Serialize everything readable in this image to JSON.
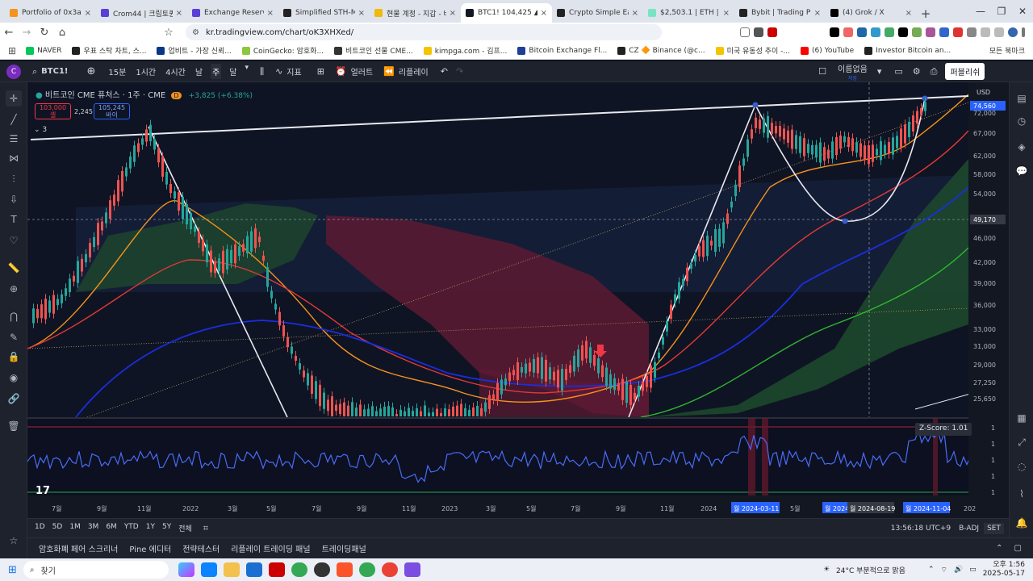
{
  "browser": {
    "tabs": [
      {
        "title": "Portfolio of 0x3a09...",
        "color": "#f7931a"
      },
      {
        "title": "Crom44 | 크립토퀀트",
        "color": "#5a3fd6"
      },
      {
        "title": "Exchange Reserve / S",
        "color": "#5a3fd6"
      },
      {
        "title": "Simplified STH-MVRV",
        "color": "#222222"
      },
      {
        "title": "현물 계정 - 지갑 - 바",
        "color": "#f0b90b"
      },
      {
        "title": "BTC1! 104,425 ▲",
        "color": "#131722"
      },
      {
        "title": "Crypto Simple Earn |",
        "color": "#222222"
      },
      {
        "title": "$2,503.1 | ETH | Hype",
        "color": "#79e4c4"
      },
      {
        "title": "Bybit | Trading Platfo",
        "color": "#222222"
      },
      {
        "title": "(4) Grok / X",
        "color": "#000000"
      }
    ],
    "url": "kr.tradingview.com/chart/oK3XHXed/",
    "bookmarks": [
      {
        "label": "NAVER",
        "color": "#03c75a"
      },
      {
        "label": "우표 스탁 차트, 스...",
        "color": "#222222"
      },
      {
        "label": "업비트 - 가장 신뢰...",
        "color": "#093687"
      },
      {
        "label": "CoinGecko: 암호화...",
        "color": "#8dc63f"
      },
      {
        "label": "비트코인 선물 CME...",
        "color": "#333333"
      },
      {
        "label": "kimpga.com - 김프...",
        "color": "#f5c400"
      },
      {
        "label": "Bitcoin Exchange Fl...",
        "color": "#1f3d99"
      },
      {
        "label": "CZ 🔶 Binance (@c...",
        "color": "#222222"
      },
      {
        "label": "미국 유동성 추이 -...",
        "color": "#f5c400"
      },
      {
        "label": "(6) YouTube",
        "color": "#ff0000"
      },
      {
        "label": "Investor Bitcoin an...",
        "color": "#222222"
      }
    ],
    "all_bookmarks": "모든 북마크"
  },
  "toolbar": {
    "symbol": "BTC1!",
    "intervals": [
      "15분",
      "1시간",
      "4시간",
      "날",
      "주",
      "달"
    ],
    "active_interval": "주",
    "indicators": "지표",
    "alert": "얼러트",
    "replay": "리플레이",
    "layout_name": "이름없음",
    "layout_sub": "저장",
    "publish": "퍼블리쉬"
  },
  "legend": {
    "title": "비트코인 CME 퓨처스 · 1주 · CME",
    "change": "+3,825 (+6.38%)",
    "sell_price": "103,000",
    "sell_label": "셀",
    "spread": "2,245",
    "buy_price": "105,245",
    "buy_label": "바이",
    "collapse": "3"
  },
  "price_axis": {
    "currency": "USD",
    "labels": [
      "74,560",
      "72,000",
      "67,000",
      "62,000",
      "58,000",
      "54,000",
      "49,170",
      "46,000",
      "42,000",
      "39,000",
      "36,000",
      "33,000",
      "31,000",
      "29,000",
      "27,250",
      "25,650"
    ],
    "current_price": "74,560",
    "crosshair_price": "49,170"
  },
  "time_axis": {
    "labels": [
      "7월",
      "9월",
      "11월",
      "2022",
      "3월",
      "5월",
      "7월",
      "9월",
      "11월",
      "2023",
      "3월",
      "5월",
      "7월",
      "9월",
      "11월",
      "2024",
      "5월",
      "202"
    ],
    "highlights": [
      "월 2024-03-11",
      "월 2024",
      "월 2024-08-19",
      "월 2024-11-04"
    ]
  },
  "zscore": {
    "label": "Z-Score: 1.01",
    "axis": [
      "1",
      "1",
      "1",
      "1",
      "1"
    ]
  },
  "range_bar": {
    "ranges": [
      "1D",
      "5D",
      "1M",
      "3M",
      "6M",
      "YTD",
      "1Y",
      "5Y",
      "전체"
    ],
    "clock": "13:56:18 UTC+9",
    "adj": "B-ADJ",
    "set": "SET"
  },
  "bottom_tabs": [
    "암호화폐 페어 스크리너",
    "Pine 에디터",
    "전략테스터",
    "리플레이 트레이딩 패널",
    "트레이딩패널"
  ],
  "taskbar": {
    "search": "찾기",
    "weather": "24°C  부분적으로 맑음",
    "time": "오후 1:56",
    "date": "2025-05-17"
  },
  "colors": {
    "accent": "#2962ff",
    "bull": "#26a69a",
    "bear": "#ef5350"
  }
}
